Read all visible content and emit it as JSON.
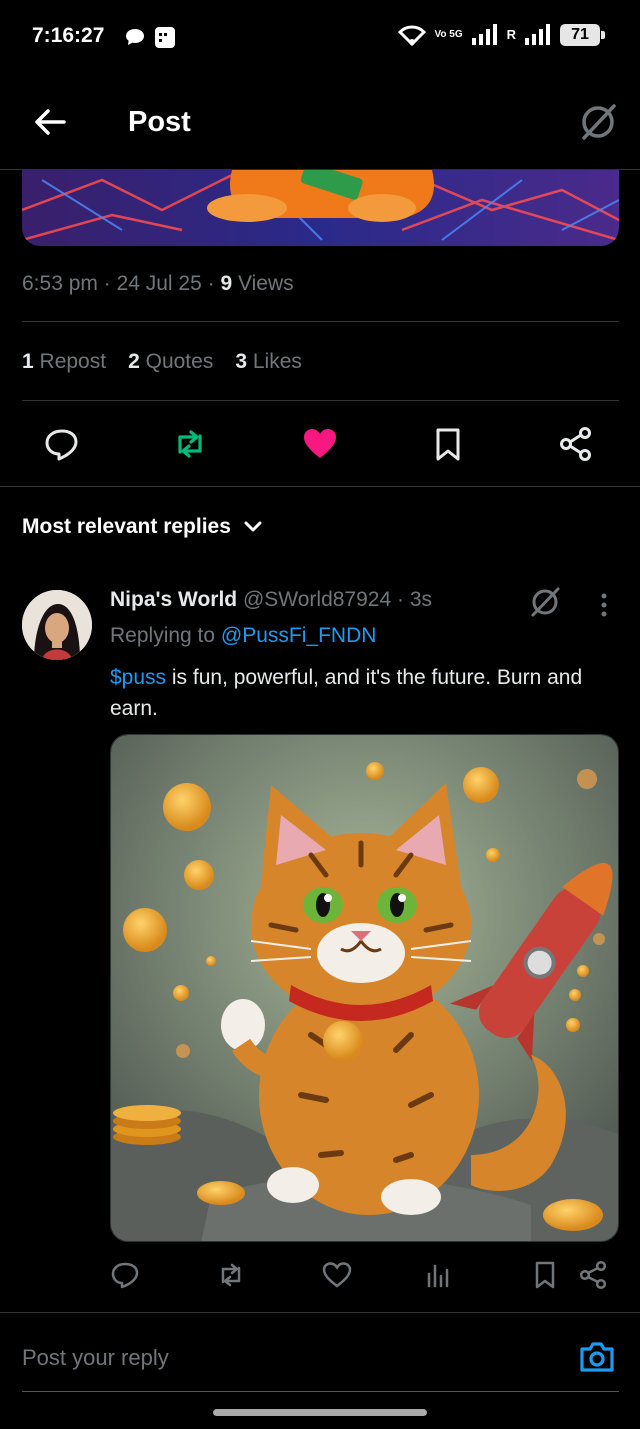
{
  "status_bar": {
    "time": "7:16:27",
    "network_label": "Vo 5G",
    "roaming_label": "R",
    "battery": "71"
  },
  "header": {
    "title": "Post"
  },
  "post": {
    "time": "6:53 pm",
    "date": "24 Jul 25",
    "views_count": "9",
    "views_label": "Views",
    "reposts_count": "1",
    "reposts_label": "Repost",
    "quotes_count": "2",
    "quotes_label": "Quotes",
    "likes_count": "3",
    "likes_label": "Likes",
    "liked": true
  },
  "replies": {
    "sort_label": "Most relevant replies",
    "items": [
      {
        "name": "Nipa's World",
        "handle": "@SWorld87924",
        "time": "3s",
        "replying_prefix": "Replying to",
        "replying_to": "@PussFi_FNDN",
        "cashtag": "$puss",
        "text_rest": " is fun,  powerful, and it's the future. Burn and earn."
      }
    ]
  },
  "compose": {
    "placeholder": "Post your reply"
  },
  "colors": {
    "background": "#000000",
    "accent": "#1d9bf0",
    "like": "#f91880",
    "repost": "#00ba7c",
    "muted": "#71767b"
  },
  "icons": [
    "back-arrow-icon",
    "grok-icon",
    "reply-icon",
    "repost-icon",
    "heart-icon",
    "bookmark-icon",
    "share-icon",
    "chevron-down-icon",
    "more-vertical-icon",
    "analytics-icon",
    "camera-icon",
    "wifi-icon",
    "signal-icon",
    "battery-icon",
    "message-icon"
  ]
}
